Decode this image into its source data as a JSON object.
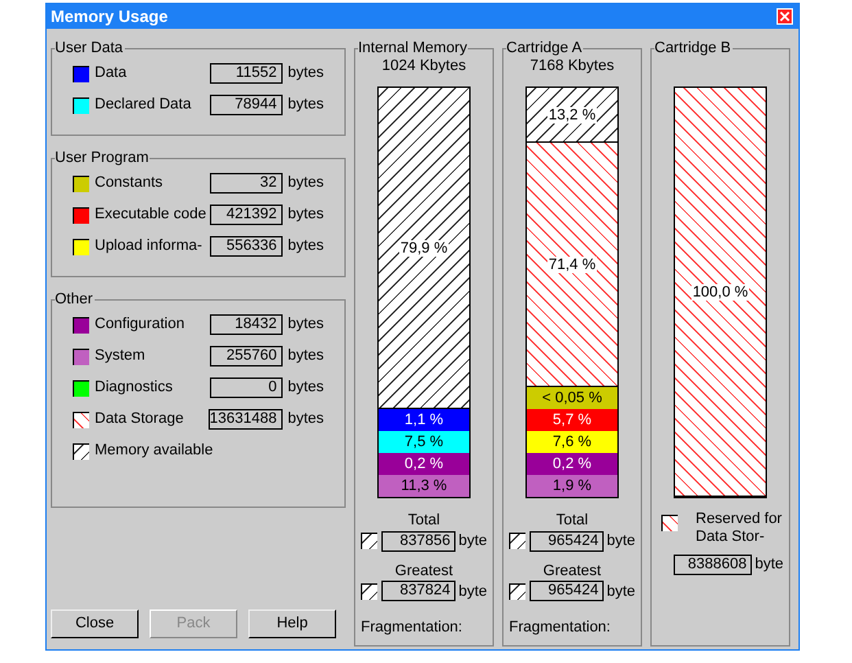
{
  "window": {
    "title": "Memory Usage"
  },
  "groups": [
    {
      "title": "User Data",
      "items": [
        {
          "kind": "solid",
          "color": "#0000ff",
          "label": "Data",
          "value": "11552",
          "unit": "bytes"
        },
        {
          "kind": "solid",
          "color": "#00ffff",
          "label": "Declared Data",
          "value": "78944",
          "unit": "bytes"
        }
      ]
    },
    {
      "title": "User Program",
      "items": [
        {
          "kind": "solid",
          "color": "#cccc00",
          "label": "Constants",
          "value": "32",
          "unit": "bytes"
        },
        {
          "kind": "solid",
          "color": "#ff0000",
          "label": "Executable code",
          "value": "421392",
          "unit": "bytes"
        },
        {
          "kind": "solid",
          "color": "#ffff00",
          "label": "Upload informa-",
          "value": "556336",
          "unit": "bytes"
        }
      ]
    },
    {
      "title": "Other",
      "items": [
        {
          "kind": "solid",
          "color": "#990099",
          "label": "Configuration",
          "value": "18432",
          "unit": "bytes"
        },
        {
          "kind": "solid",
          "color": "#c060c0",
          "label": "System",
          "value": "255760",
          "unit": "bytes"
        },
        {
          "kind": "solid",
          "color": "#00ff00",
          "label": "Diagnostics",
          "value": "0",
          "unit": "bytes"
        },
        {
          "kind": "storage",
          "label": "Data Storage",
          "value": "13631488",
          "unit": "bytes"
        },
        {
          "kind": "free",
          "label": "Memory available"
        }
      ]
    }
  ],
  "buttons": [
    {
      "label": "Close",
      "disabled": false
    },
    {
      "label": "Pack",
      "disabled": true
    },
    {
      "label": "Help",
      "disabled": false
    }
  ],
  "memories": [
    {
      "title": "Internal Memory",
      "capacity": "1024 Kbytes",
      "segments": [
        {
          "kind": "free",
          "label": "79,9 %"
        },
        {
          "kind": "solid",
          "color": "#0000ff",
          "label": "1,1 %"
        },
        {
          "kind": "solid",
          "color": "#00ffff",
          "label": "7,5 %"
        },
        {
          "kind": "solid",
          "color": "#990099",
          "label": "0,2 %"
        },
        {
          "kind": "solid",
          "color": "#c060c0",
          "label": "11,3 %"
        }
      ],
      "stats": [
        {
          "kind": "inline",
          "label": "Total",
          "swatch": {
            "kind": "free"
          },
          "value": "837856",
          "unit": "byte"
        },
        {
          "kind": "inline",
          "label": "Greatest",
          "swatch": {
            "kind": "free"
          },
          "value": "837824",
          "unit": "byte"
        }
      ],
      "note": "Fragmentation:"
    },
    {
      "title": "Cartridge A",
      "capacity": "7168 Kbytes",
      "segments": [
        {
          "kind": "free",
          "label": "13,2 %"
        },
        {
          "kind": "storage",
          "label": "71,4 %"
        },
        {
          "kind": "solid",
          "color": "#cccc00",
          "label": "< 0,05 %"
        },
        {
          "kind": "solid",
          "color": "#ff0000",
          "label": "5,7 %"
        },
        {
          "kind": "solid",
          "color": "#ffff00",
          "label": "7,6 %"
        },
        {
          "kind": "solid",
          "color": "#990099",
          "label": "0,2 %"
        },
        {
          "kind": "solid",
          "color": "#c060c0",
          "label": "1,9 %"
        }
      ],
      "stats": [
        {
          "kind": "inline",
          "label": "Total",
          "swatch": {
            "kind": "free"
          },
          "value": "965424",
          "unit": "byte"
        },
        {
          "kind": "inline",
          "label": "Greatest",
          "swatch": {
            "kind": "free"
          },
          "value": "965424",
          "unit": "byte"
        }
      ],
      "note": "Fragmentation:"
    },
    {
      "title": "Cartridge B",
      "segments": [
        {
          "kind": "storage",
          "label": "100,0 %"
        }
      ],
      "stats": [
        {
          "kind": "stacked",
          "label": "Reserved for Data Stor-",
          "swatch": {
            "kind": "storage"
          },
          "value": "8388608",
          "unit": "byte"
        }
      ]
    }
  ]
}
